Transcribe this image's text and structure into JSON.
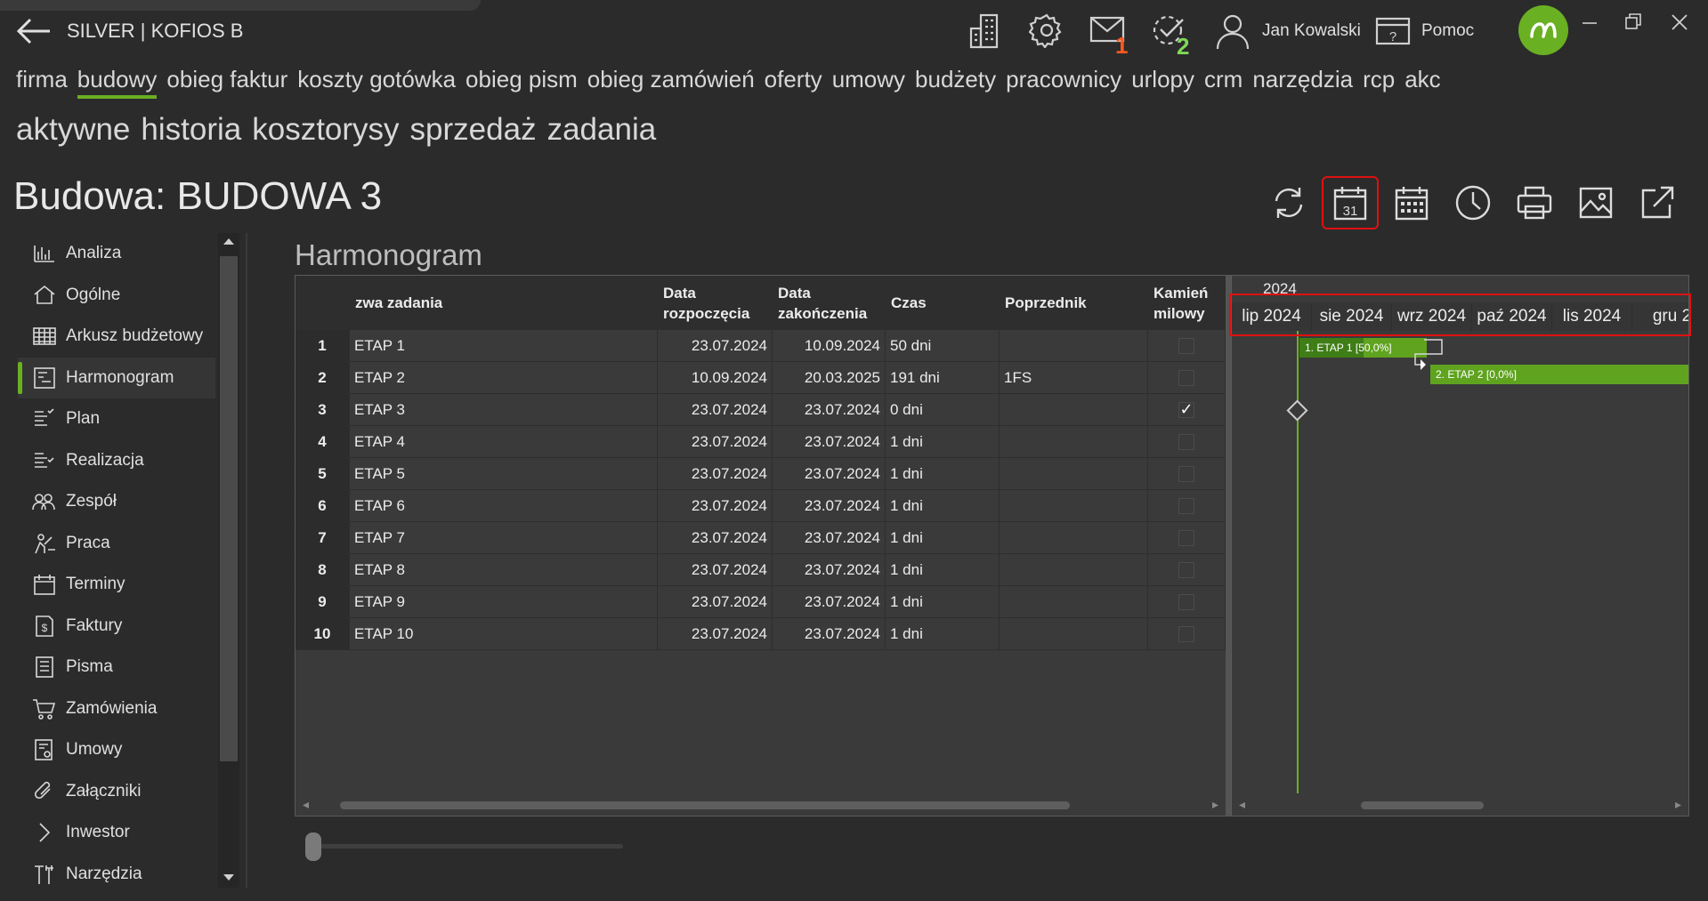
{
  "titlebar": {
    "app_title": "SILVER | KOFIOS B",
    "mail_badge": "1",
    "tasks_badge": "2",
    "user_name": "Jan Kowalski",
    "help_label": "Pomoc",
    "mail_badge_color": "#ff5a1f",
    "tasks_badge_color": "#7ed957"
  },
  "nav": {
    "modules": [
      "firma",
      "budowy",
      "obieg faktur",
      "koszty gotówka",
      "obieg pism",
      "obieg zamówień",
      "oferty",
      "umowy",
      "budżety",
      "pracownicy",
      "urlopy",
      "crm",
      "narzędzia",
      "rcp",
      "akce"
    ],
    "active_module": "budowy",
    "subtabs": [
      "aktywne",
      "historia",
      "kosztorysy",
      "sprzedaż",
      "zadania"
    ]
  },
  "page": {
    "title": "Budowa: BUDOWA 3",
    "section_title": "Harmonogram"
  },
  "toolbar": {
    "icons": [
      "refresh-icon",
      "calendar-31-icon",
      "calendar-grid-icon",
      "clock-icon",
      "print-icon",
      "image-icon",
      "external-link-icon"
    ],
    "selected": "calendar-31-icon",
    "calendar_day": "31"
  },
  "sidebar": {
    "items": [
      {
        "label": "Analiza",
        "icon": "bar-chart-icon"
      },
      {
        "label": "Ogólne",
        "icon": "home-icon"
      },
      {
        "label": "Arkusz budżetowy",
        "icon": "spreadsheet-icon"
      },
      {
        "label": "Harmonogram",
        "icon": "schedule-icon",
        "active": true
      },
      {
        "label": "Plan",
        "icon": "plan-list-icon"
      },
      {
        "label": "Realizacja",
        "icon": "realization-list-icon"
      },
      {
        "label": "Zespół",
        "icon": "team-icon"
      },
      {
        "label": "Praca",
        "icon": "worker-icon"
      },
      {
        "label": "Terminy",
        "icon": "calendar-icon"
      },
      {
        "label": "Faktury",
        "icon": "invoice-icon"
      },
      {
        "label": "Pisma",
        "icon": "document-icon"
      },
      {
        "label": "Zamówienia",
        "icon": "cart-icon"
      },
      {
        "label": "Umowy",
        "icon": "contract-icon"
      },
      {
        "label": "Załączniki",
        "icon": "paperclip-icon"
      },
      {
        "label": "Inwestor",
        "icon": "chevron-right-icon"
      },
      {
        "label": "Narzędzia",
        "icon": "tools-icon"
      }
    ]
  },
  "grid": {
    "headers": {
      "name": "zwa zadania",
      "start_line1": "Data",
      "start_line2": "rozpoczęcia",
      "end_line1": "Data",
      "end_line2": "zakończenia",
      "duration": "Czas",
      "predecessor": "Poprzednik",
      "milestone_line1": "Kamień",
      "milestone_line2": "milowy"
    },
    "rows": [
      {
        "num": "1",
        "name": "ETAP 1",
        "start": "23.07.2024",
        "end": "10.09.2024",
        "duration": "50 dni",
        "pred": "",
        "milestone": false
      },
      {
        "num": "2",
        "name": "ETAP 2",
        "start": "10.09.2024",
        "end": "20.03.2025",
        "duration": "191 dni",
        "pred": "1FS",
        "milestone": false
      },
      {
        "num": "3",
        "name": "ETAP 3",
        "start": "23.07.2024",
        "end": "23.07.2024",
        "duration": "0 dni",
        "pred": "",
        "milestone": true
      },
      {
        "num": "4",
        "name": "ETAP 4",
        "start": "23.07.2024",
        "end": "23.07.2024",
        "duration": "1 dni",
        "pred": "",
        "milestone": false
      },
      {
        "num": "5",
        "name": "ETAP 5",
        "start": "23.07.2024",
        "end": "23.07.2024",
        "duration": "1 dni",
        "pred": "",
        "milestone": false
      },
      {
        "num": "6",
        "name": "ETAP 6",
        "start": "23.07.2024",
        "end": "23.07.2024",
        "duration": "1 dni",
        "pred": "",
        "milestone": false
      },
      {
        "num": "7",
        "name": "ETAP 7",
        "start": "23.07.2024",
        "end": "23.07.2024",
        "duration": "1 dni",
        "pred": "",
        "milestone": false
      },
      {
        "num": "8",
        "name": "ETAP 8",
        "start": "23.07.2024",
        "end": "23.07.2024",
        "duration": "1 dni",
        "pred": "",
        "milestone": false
      },
      {
        "num": "9",
        "name": "ETAP 9",
        "start": "23.07.2024",
        "end": "23.07.2024",
        "duration": "1 dni",
        "pred": "",
        "milestone": false
      },
      {
        "num": "10",
        "name": "ETAP 10",
        "start": "23.07.2024",
        "end": "23.07.2024",
        "duration": "1 dni",
        "pred": "",
        "milestone": false
      }
    ]
  },
  "gantt": {
    "year": "2024",
    "months": [
      "lip 2024",
      "sie 2024",
      "wrz 2024",
      "paź 2024",
      "lis 2024",
      "gru 2"
    ],
    "bars": [
      {
        "label": "1. ETAP 1 [50,0%]",
        "progress": 0.5
      },
      {
        "label": "2. ETAP 2 [0,0%]",
        "progress": 0.0
      }
    ],
    "bar_color": "#5fa31f",
    "progress_color": "#3f7d16"
  }
}
